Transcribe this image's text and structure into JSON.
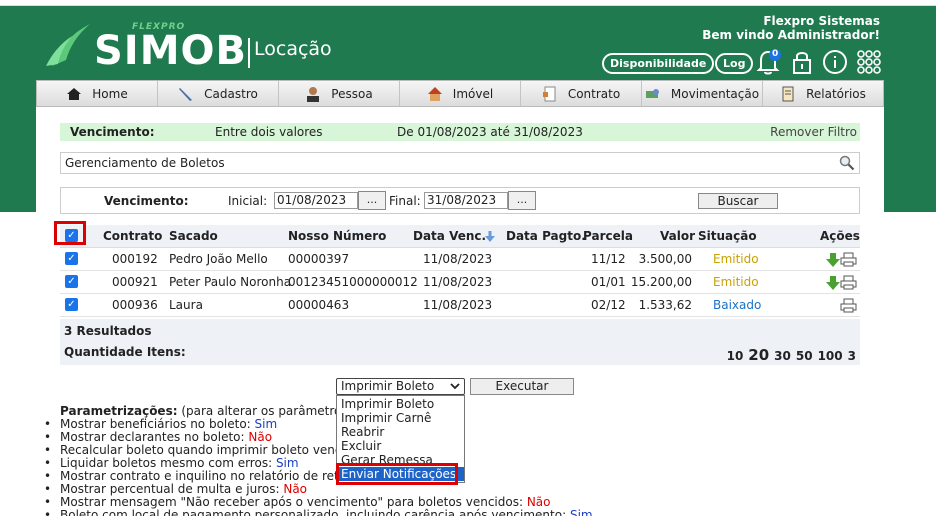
{
  "header": {
    "brand": "FLEXPRO",
    "app_name": "SIMOB",
    "app_module": "Locação",
    "company": "Flexpro Sistemas",
    "welcome": "Bem vindo Administrador!",
    "btn_disponibilidade": "Disponibilidade",
    "btn_log": "Log",
    "notification_count": "0"
  },
  "nav": [
    {
      "label": "Home",
      "icon": "home-icon"
    },
    {
      "label": "Cadastro",
      "icon": "pencil-icon"
    },
    {
      "label": "Pessoa",
      "icon": "person-icon"
    },
    {
      "label": "Imóvel",
      "icon": "house-icon"
    },
    {
      "label": "Contrato",
      "icon": "contract-icon"
    },
    {
      "label": "Movimentação",
      "icon": "money-icon"
    },
    {
      "label": "Relatórios",
      "icon": "report-icon"
    }
  ],
  "filter": {
    "label": "Vencimento:",
    "type": "Entre dois valores",
    "range": "De 01/08/2023 até 31/08/2023",
    "remove": "Remover Filtro"
  },
  "section_title": "Gerenciamento de Boletos",
  "form": {
    "label": "Vencimento:",
    "initial_label": "Inicial:",
    "initial_value": "01/08/2023",
    "final_label": "Final:",
    "final_value": "31/08/2023",
    "dots": "...",
    "search": "Buscar"
  },
  "table": {
    "headers": {
      "contrato": "Contrato",
      "sacado": "Sacado",
      "nosso_numero": "Nosso Número",
      "data_venc": "Data Venc.",
      "data_pagto": "Data Pagto.",
      "parcela": "Parcela",
      "valor": "Valor",
      "situacao": "Situação",
      "acoes": "Ações"
    },
    "rows": [
      {
        "contrato": "000192",
        "sacado": "Pedro João Mello",
        "nosso_numero": "00000397",
        "data_venc": "11/08/2023",
        "data_pagto": "",
        "parcela": "11/12",
        "valor": "3.500,00",
        "situacao": "Emitido",
        "status_color": "#c9a200"
      },
      {
        "contrato": "000921",
        "sacado": "Peter Paulo Noronha",
        "nosso_numero": "00123451000000012",
        "data_venc": "11/08/2023",
        "data_pagto": "",
        "parcela": "01/01",
        "valor": "15.200,00",
        "situacao": "Emitido",
        "status_color": "#c9a200"
      },
      {
        "contrato": "000936",
        "sacado": "Laura",
        "nosso_numero": "00000463",
        "data_venc": "11/08/2023",
        "data_pagto": "",
        "parcela": "02/12",
        "valor": "1.533,62",
        "situacao": "Baixado",
        "status_color": "#1a73c8"
      }
    ]
  },
  "summary": {
    "results": "3 Resultados",
    "qty_label": "Quantidade Itens:",
    "page_sizes": [
      "10",
      "20",
      "30",
      "50",
      "100",
      "3"
    ]
  },
  "action": {
    "selected": "Imprimir Boleto",
    "execute": "Executar",
    "options": [
      "Imprimir Boleto",
      "Imprimir Carnê",
      "Reabrir",
      "Excluir",
      "Gerar Remessa",
      "Enviar Notificações"
    ]
  },
  "params": {
    "title": "Parametrizações:",
    "subtitle": "(para alterar os parâmetros, c",
    "items": [
      {
        "text": "Mostrar beneficiários no boleto: ",
        "value": "Sim"
      },
      {
        "text": "Mostrar declarantes no boleto: ",
        "value": "Não"
      },
      {
        "text": "Recalcular boleto quando imprimir boleto vencido",
        "value": ""
      },
      {
        "text": "Liquidar boletos mesmo com erros: ",
        "value": "Sim"
      },
      {
        "text": "Mostrar contrato e inquilino no relatório de retorn",
        "value": ""
      },
      {
        "text": "Mostrar percentual de multa e juros: ",
        "value": "Não"
      },
      {
        "text": "Mostrar mensagem \"Não receber após o vencimento\" para boletos vencidos: ",
        "value": "Não"
      },
      {
        "text": "Boleto com local de pagamento personalizado, incluindo carência após vencimento: ",
        "value": "Sim"
      }
    ]
  }
}
